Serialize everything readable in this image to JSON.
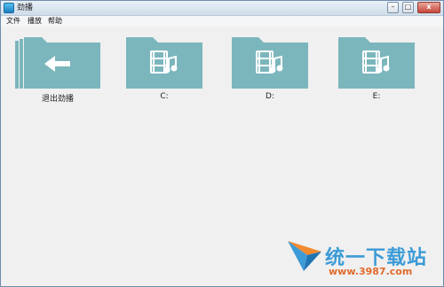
{
  "window": {
    "title": "劲播"
  },
  "menu": [
    {
      "label": "文件"
    },
    {
      "label": "播放"
    },
    {
      "label": "帮助"
    }
  ],
  "folders": [
    {
      "label": "退出劲播",
      "icon": "back-arrow-icon"
    },
    {
      "label": "C:",
      "icon": "film-music-icon"
    },
    {
      "label": "D:",
      "icon": "film-music-icon"
    },
    {
      "label": "E:",
      "icon": "film-music-icon"
    }
  ],
  "colors": {
    "folder": "#7bb6bd",
    "watermark_blue": "#3c9bd6",
    "watermark_orange": "#e06a2c"
  },
  "watermark": {
    "brand": "统一下载站",
    "url": "www.3987.com"
  }
}
